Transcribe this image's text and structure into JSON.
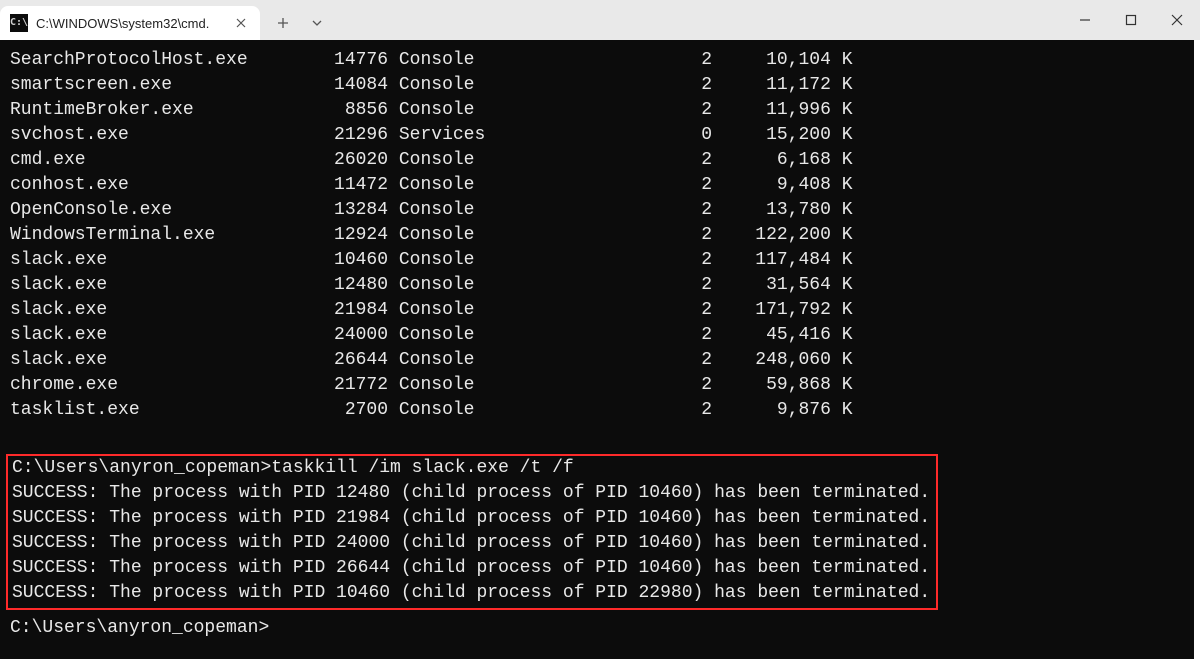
{
  "window": {
    "tab_title": "C:\\WINDOWS\\system32\\cmd."
  },
  "processes": [
    {
      "name": "SearchProtocolHost.exe",
      "pid": "14776",
      "session": "Console",
      "sid": "2",
      "mem": "10,104 K"
    },
    {
      "name": "smartscreen.exe",
      "pid": "14084",
      "session": "Console",
      "sid": "2",
      "mem": "11,172 K"
    },
    {
      "name": "RuntimeBroker.exe",
      "pid": "8856",
      "session": "Console",
      "sid": "2",
      "mem": "11,996 K"
    },
    {
      "name": "svchost.exe",
      "pid": "21296",
      "session": "Services",
      "sid": "0",
      "mem": "15,200 K"
    },
    {
      "name": "cmd.exe",
      "pid": "26020",
      "session": "Console",
      "sid": "2",
      "mem": "6,168 K"
    },
    {
      "name": "conhost.exe",
      "pid": "11472",
      "session": "Console",
      "sid": "2",
      "mem": "9,408 K"
    },
    {
      "name": "OpenConsole.exe",
      "pid": "13284",
      "session": "Console",
      "sid": "2",
      "mem": "13,780 K"
    },
    {
      "name": "WindowsTerminal.exe",
      "pid": "12924",
      "session": "Console",
      "sid": "2",
      "mem": "122,200 K"
    },
    {
      "name": "slack.exe",
      "pid": "10460",
      "session": "Console",
      "sid": "2",
      "mem": "117,484 K"
    },
    {
      "name": "slack.exe",
      "pid": "12480",
      "session": "Console",
      "sid": "2",
      "mem": "31,564 K"
    },
    {
      "name": "slack.exe",
      "pid": "21984",
      "session": "Console",
      "sid": "2",
      "mem": "171,792 K"
    },
    {
      "name": "slack.exe",
      "pid": "24000",
      "session": "Console",
      "sid": "2",
      "mem": "45,416 K"
    },
    {
      "name": "slack.exe",
      "pid": "26644",
      "session": "Console",
      "sid": "2",
      "mem": "248,060 K"
    },
    {
      "name": "chrome.exe",
      "pid": "21772",
      "session": "Console",
      "sid": "2",
      "mem": "59,868 K"
    },
    {
      "name": "tasklist.exe",
      "pid": "2700",
      "session": "Console",
      "sid": "2",
      "mem": "9,876 K"
    }
  ],
  "highlight": {
    "command_line": "C:\\Users\\anyron_copeman>taskkill /im slack.exe /t /f",
    "results": [
      "SUCCESS: The process with PID 12480 (child process of PID 10460) has been terminated.",
      "SUCCESS: The process with PID 21984 (child process of PID 10460) has been terminated.",
      "SUCCESS: The process with PID 24000 (child process of PID 10460) has been terminated.",
      "SUCCESS: The process with PID 26644 (child process of PID 10460) has been terminated.",
      "SUCCESS: The process with PID 10460 (child process of PID 22980) has been terminated."
    ]
  },
  "prompt": "C:\\Users\\anyron_copeman>"
}
